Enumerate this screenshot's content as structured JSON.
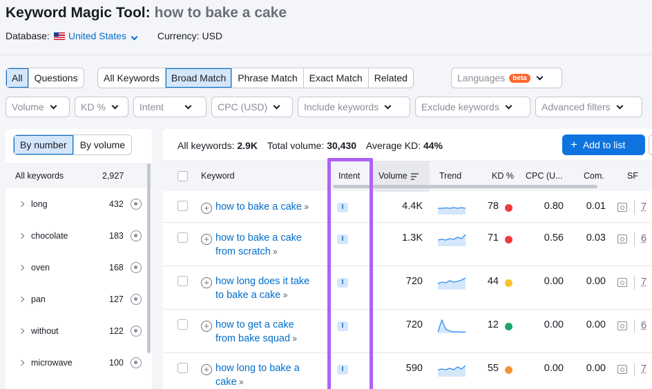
{
  "header": {
    "title": "Keyword Magic Tool:",
    "query": "how to bake a cake",
    "database_label": "Database:",
    "database_value": "United States",
    "currency": "Currency: USD"
  },
  "match_tabs": [
    "All",
    "Questions"
  ],
  "broad_tabs": [
    "All Keywords",
    "Broad Match",
    "Phrase Match",
    "Exact Match",
    "Related"
  ],
  "languages": {
    "label": "Languages",
    "badge": "beta"
  },
  "filters": [
    "Volume",
    "KD %",
    "Intent",
    "CPC (USD)",
    "Include keywords",
    "Exclude keywords",
    "Advanced filters"
  ],
  "left": {
    "tabs": [
      "By number",
      "By volume"
    ],
    "header_label": "All keywords",
    "header_count": "2,927",
    "groups": [
      {
        "name": "long",
        "count": "432"
      },
      {
        "name": "chocolate",
        "count": "183"
      },
      {
        "name": "oven",
        "count": "168"
      },
      {
        "name": "pan",
        "count": "127"
      },
      {
        "name": "without",
        "count": "122"
      },
      {
        "name": "microwave",
        "count": "100"
      }
    ]
  },
  "summary": {
    "all_label": "All keywords:",
    "all_value": "2.9K",
    "total_label": "Total volume:",
    "total_value": "30,430",
    "kd_label": "Average KD:",
    "kd_value": "44%",
    "add_button": "Add to list"
  },
  "columns": {
    "keyword": "Keyword",
    "intent": "Intent",
    "volume": "Volume",
    "trend": "Trend",
    "kd": "KD %",
    "cpc": "CPC (U...",
    "com": "Com.",
    "sf": "SF"
  },
  "rows": [
    {
      "line1": "how to bake a cake",
      "line2": "",
      "intent": "I",
      "volume": "4.4K",
      "kd": "78",
      "kd_color": "#ef3b3b",
      "cpc": "0.80",
      "com": "0.01",
      "sf": "7",
      "trend": [
        0.55,
        0.55,
        0.52,
        0.55,
        0.5,
        0.55,
        0.5,
        0.55
      ]
    },
    {
      "line1": "how to bake a cake",
      "line2": "from scratch",
      "intent": "I",
      "volume": "1.3K",
      "kd": "71",
      "kd_color": "#ef3b3b",
      "cpc": "0.56",
      "com": "0.03",
      "sf": "6",
      "trend": [
        0.55,
        0.5,
        0.55,
        0.45,
        0.5,
        0.35,
        0.45,
        0.15
      ]
    },
    {
      "line1": "how long does it take",
      "line2": "to bake a cake",
      "intent": "I",
      "volume": "720",
      "kd": "44",
      "kd_color": "#f5c12e",
      "cpc": "0.00",
      "com": "0.00",
      "sf": "7",
      "trend": [
        0.55,
        0.45,
        0.5,
        0.35,
        0.45,
        0.4,
        0.3,
        0.15
      ]
    },
    {
      "line1": "how to get a cake",
      "line2": "from bake squad",
      "intent": "I",
      "volume": "720",
      "kd": "12",
      "kd_color": "#1ea36b",
      "cpc": "0.00",
      "com": "0.00",
      "sf": "6",
      "trend": [
        0.92,
        0.05,
        0.7,
        0.85,
        0.9,
        0.9,
        0.92,
        0.92
      ]
    },
    {
      "line1": "how long to bake a",
      "line2": "cake",
      "intent": "I",
      "volume": "590",
      "kd": "55",
      "kd_color": "#f39337",
      "cpc": "0.00",
      "com": "0.00",
      "sf": "7",
      "trend": [
        0.5,
        0.45,
        0.5,
        0.4,
        0.5,
        0.3,
        0.45,
        0.2
      ]
    }
  ],
  "colors": {
    "accent": "#006dca",
    "highlight": "#b061f4",
    "primary_button": "#0f74e0"
  }
}
